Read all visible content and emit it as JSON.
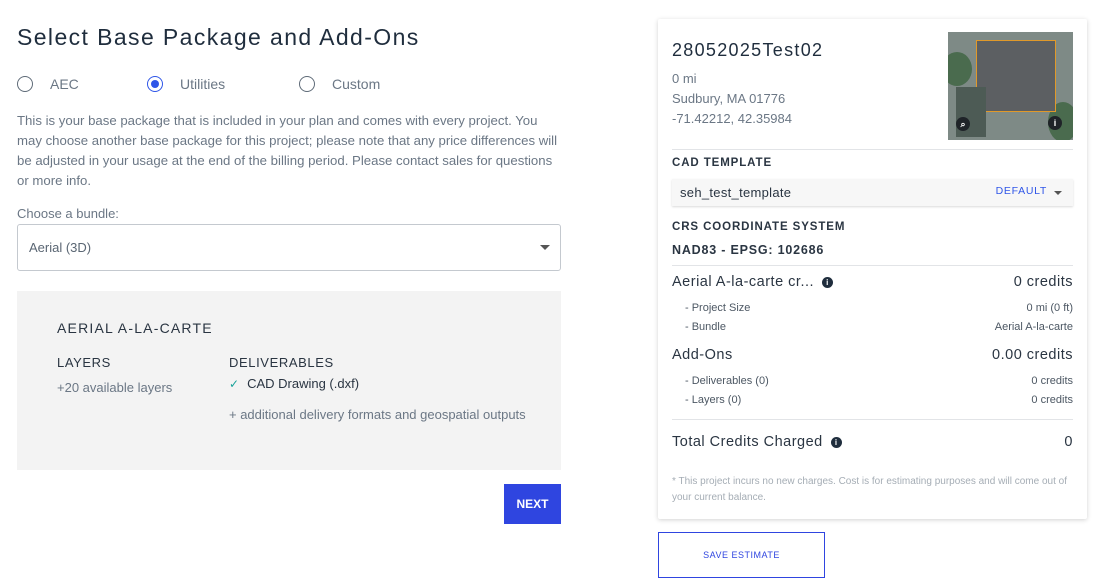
{
  "page": {
    "title": "Select Base Package and Add-Ons"
  },
  "packages": {
    "options": [
      "AEC",
      "Utilities",
      "Custom"
    ],
    "selected": "Utilities"
  },
  "description": "This is your base package that is included in your plan and comes with every project. You may choose another base package for this project; please note that any price differences will be adjusted in your usage at the end of the billing period. Please contact sales for questions or more info.",
  "bundle": {
    "label": "Choose a bundle:",
    "value": "Aerial (3D)"
  },
  "package_card": {
    "title": "AERIAL A-LA-CARTE",
    "layers_heading": "LAYERS",
    "layers_text": "+20 available layers",
    "deliverables_heading": "DELIVERABLES",
    "deliverable_item": "CAD Drawing (.dxf)",
    "deliverables_more": "+ additional delivery formats and geospatial outputs"
  },
  "next_label": "NEXT",
  "summary": {
    "project_name": "28052025Test02",
    "distance": "0 mi",
    "location": "Sudbury, MA 01776",
    "coordinates": "-71.42212, 42.35984",
    "cad_template_heading": "CAD TEMPLATE",
    "cad_template_value": "seh_test_template",
    "cad_template_default": "DEFAULT",
    "crs_heading": "CRS COORDINATE SYSTEM",
    "crs_value": "NAD83 - EPSG: 102686",
    "base_label": "Aerial A-la-carte cr...",
    "base_credits": "0 credits",
    "project_size_label": "- Project Size",
    "project_size_value": "0 mi (0 ft)",
    "bundle_label": "- Bundle",
    "bundle_value": "Aerial A-la-carte",
    "addons_label": "Add-Ons",
    "addons_credits": "0.00 credits",
    "deliverables_label": "- Deliverables (0)",
    "deliverables_value": "0 credits",
    "layers_label": "- Layers (0)",
    "layers_value": "0 credits",
    "total_label": "Total Credits Charged",
    "total_value": "0",
    "footnote": "* This project incurs no new charges. Cost is for estimating purposes and will come out of your current balance."
  },
  "save_label": "SAVE ESTIMATE",
  "colors": {
    "accent": "#2f45e0",
    "radio_selected": "#2f56e8",
    "check": "#1aa39a"
  },
  "icons": {
    "info": "info-icon",
    "check": "check-icon",
    "caret": "chevron-down-icon"
  }
}
